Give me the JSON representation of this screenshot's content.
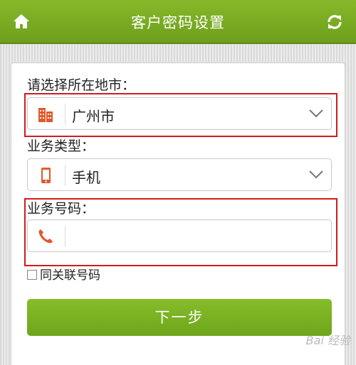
{
  "header": {
    "title": "客户密码设置",
    "home_icon": "home-icon",
    "refresh_icon": "refresh-icon",
    "color": "#7aad22"
  },
  "form": {
    "city_label": "请选择所在地市：",
    "city_value": "广州市",
    "city_icon": "building-icon",
    "service_type_label": "业务类型：",
    "service_type_value": "手机",
    "service_type_icon": "mobile-phone-icon",
    "service_number_label": "业务号码：",
    "service_number_value": "",
    "service_number_icon": "phone-handset-icon",
    "associated_number_checkbox_label": "同关联号码",
    "associated_number_checked": false,
    "next_button_label": "下一步",
    "accent_color": "#e05a2b",
    "highlight_color": "#d21b1b"
  },
  "watermark": "Bai 经验"
}
